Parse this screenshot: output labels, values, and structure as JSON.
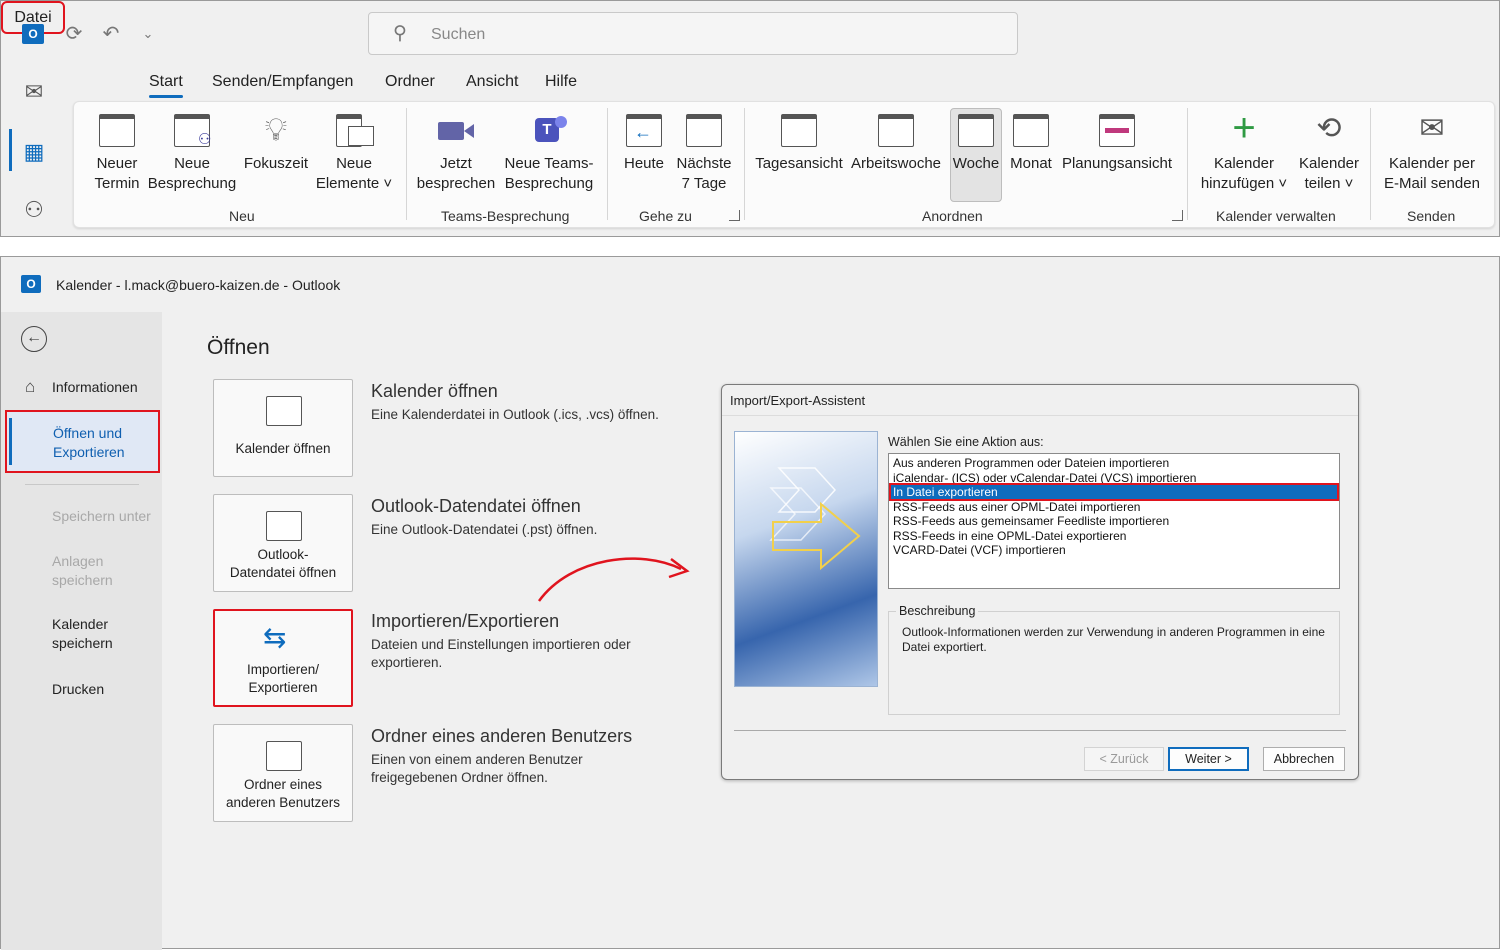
{
  "ribbon_window": {
    "search_placeholder": "Suchen",
    "tabs": [
      "Datei",
      "Start",
      "Senden/Empfangen",
      "Ordner",
      "Ansicht",
      "Hilfe"
    ],
    "groups": {
      "neu": {
        "label": "Neu",
        "buttons": [
          "Neuer\nTermin",
          "Neue\nBesprechung",
          "Fokuszeit",
          "Neue\nElemente ˅"
        ]
      },
      "teams": {
        "label": "Teams-Besprechung",
        "buttons": [
          "Jetzt\nbesprechen",
          "Neue Teams-\nBesprechung"
        ]
      },
      "gehezu": {
        "label": "Gehe zu",
        "buttons": [
          "Heute",
          "Nächste\n7 Tage"
        ]
      },
      "anordnen": {
        "label": "Anordnen",
        "buttons": [
          "Tagesansicht",
          "Arbeitswoche",
          "Woche",
          "Monat",
          "Planungsansicht"
        ]
      },
      "verwalten": {
        "label": "Kalender verwalten",
        "buttons": [
          "Kalender\nhinzufügen ˅",
          "Kalender\nteilen ˅"
        ]
      },
      "senden": {
        "label": "Senden",
        "buttons": [
          "Kalender per\nE-Mail senden"
        ]
      }
    }
  },
  "backstage": {
    "window_title": "Kalender - l.mack@buero-kaizen.de  -  Outlook",
    "sidebar": {
      "informationen": "Informationen",
      "selected": "Öffnen und\nExportieren",
      "speichern_unter": "Speichern unter",
      "anlagen": "Anlagen\nspeichern",
      "kalender_speichern": "Kalender\nspeichern",
      "drucken": "Drucken"
    },
    "heading": "Öffnen",
    "options": [
      {
        "card": "Kalender öffnen",
        "title": "Kalender öffnen",
        "desc": "Eine Kalenderdatei in Outlook (.ics, .vcs) öffnen."
      },
      {
        "card": "Outlook-\nDatendatei öffnen",
        "title": "Outlook-Datendatei öffnen",
        "desc": "Eine Outlook-Datendatei (.pst) öffnen."
      },
      {
        "card": "Importieren/\nExportieren",
        "title": "Importieren/Exportieren",
        "desc": "Dateien und Einstellungen importieren oder exportieren."
      },
      {
        "card": "Ordner eines\nanderen Benutzers",
        "title": "Ordner eines anderen Benutzers",
        "desc": "Einen von einem anderen Benutzer freigegebenen Ordner öffnen."
      }
    ],
    "dialog": {
      "title": "Import/Export-Assistent",
      "prompt": "Wählen Sie eine Aktion aus:",
      "actions": [
        "Aus anderen Programmen oder Dateien importieren",
        "iCalendar- (ICS) oder vCalendar-Datei (VCS) importieren",
        "In Datei exportieren",
        "RSS-Feeds aus einer OPML-Datei importieren",
        "RSS-Feeds aus gemeinsamer Feedliste importieren",
        "RSS-Feeds in eine OPML-Datei exportieren",
        "VCARD-Datei (VCF) importieren"
      ],
      "selected_action": "In Datei exportieren",
      "description_label": "Beschreibung",
      "description": "Outlook-Informationen werden zur Verwendung in anderen Programmen in eine Datei exportiert.",
      "buttons": {
        "back": "< Zurück",
        "next": "Weiter >",
        "cancel": "Abbrechen"
      }
    }
  },
  "colors": {
    "accent": "#0f6cbd",
    "highlight_frame": "#e0141e"
  },
  "icons": [
    "outlook-icon",
    "sync-icon",
    "undo-icon",
    "search-icon",
    "mail-icon",
    "calendar-icon",
    "people-icon",
    "back-arrow-icon",
    "home-icon",
    "folder-icon",
    "swap-arrows-icon"
  ]
}
